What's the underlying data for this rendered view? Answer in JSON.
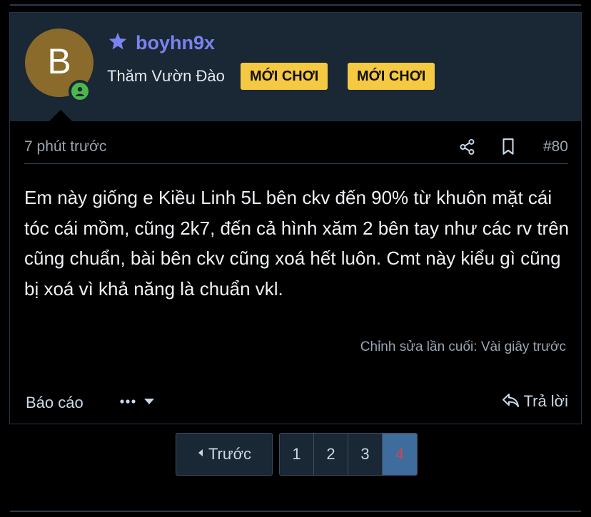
{
  "post": {
    "author": {
      "avatar_letter": "B",
      "avatar_color": "#8a6b2c",
      "username": "boyhn9x",
      "username_color": "#7a83f0",
      "title": "Thăm Vườn Đào",
      "badges": [
        "MỚI CHƠI",
        "MỚI CHƠI"
      ],
      "badge_color": "#f6c942",
      "icons": [
        "star-icon",
        "online-status-icon"
      ]
    },
    "timestamp": "7 phút trước",
    "post_number": "#80",
    "body": "Em này giống e Kiều Linh 5L bên ckv đến 90% từ khuôn mặt cái tóc cái mồm, cũng 2k7, đến cả hình xăm 2 bên tay như các rv trên cũng chuẩn, bài bên ckv cũng xoá hết luôn. Cmt này kiểu gì cũng bị xoá vì khả năng là chuẩn vkl.",
    "edit_note": "Chỉnh sửa lần cuối: Vài giây trước",
    "actions": {
      "report": "Báo cáo",
      "reply": "Trả lời"
    }
  },
  "pagination": {
    "prev_label": "Trước",
    "pages": [
      "1",
      "2",
      "3",
      "4"
    ],
    "current_page": "4",
    "active_bg": "#3e6c9c"
  }
}
